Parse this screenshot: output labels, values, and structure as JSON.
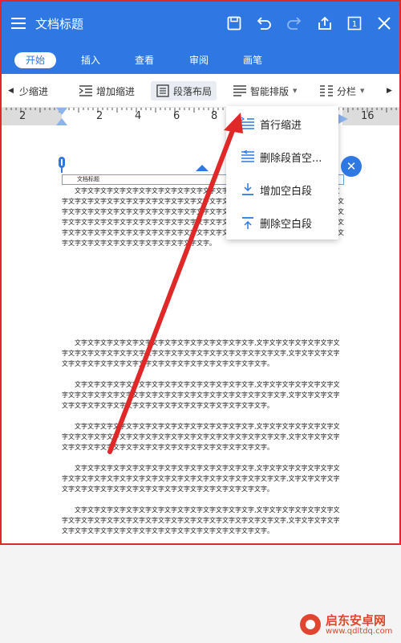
{
  "app": {
    "title": "文档标题"
  },
  "tabs": [
    {
      "label": "开始"
    },
    {
      "label": "插入"
    },
    {
      "label": "查看"
    },
    {
      "label": "审阅"
    },
    {
      "label": "画笔"
    }
  ],
  "toolbar": {
    "decrease_indent": "少缩进",
    "increase_indent": "增加缩进",
    "paragraph_layout": "段落布局",
    "smart_layout": "智能排版",
    "columns": "分栏"
  },
  "ruler": {
    "numbers": [
      "2",
      "2",
      "4",
      "6",
      "8",
      "16"
    ]
  },
  "dropdown": {
    "items": [
      {
        "label": "首行缩进"
      },
      {
        "label": "删除段首空..."
      },
      {
        "label": "增加空白段"
      },
      {
        "label": "删除空白段"
      }
    ]
  },
  "document": {
    "title": "文档标题",
    "para1": "文字文字文字文字文字文字文字文字文字文字文字文字文字文字,文字文字文字文字文字文字文字文字文字文字文字文字文字文字文字文字文字文字文字文字文字文字文字文字文字文字文字文字文字文字文字文字文字文字文字文字文字文字文字文字文字文字文字文字文字文字文字文字文字文字文字文字文字文字文字文字文字文字文字文字文字文字文字文字文字文字文字文字文字文字文字文字文字文字文字文字文字文字文字文字文字文字文字文字文字文字文字文字文字文字文字文字文字文字文字文字文字文字文字文字文字文字文字文字文字文字。",
    "body_para": "文字文字文字文字文字文字文字文字文字文字文字文字文字文字,文字文字文字文字文字文字文字文字文字文字文字文字文字文字文字文字文字文字文字文字文字文字文字文字,文字文字文字文字文字文字文字文字文字文字文字文字文字文字文字文字文字文字文字文字。"
  },
  "watermark": {
    "name": "启东安卓网",
    "url": "www.qdltdq.com"
  },
  "colors": {
    "brand": "#2f78e4",
    "annotation": "#e02828"
  }
}
